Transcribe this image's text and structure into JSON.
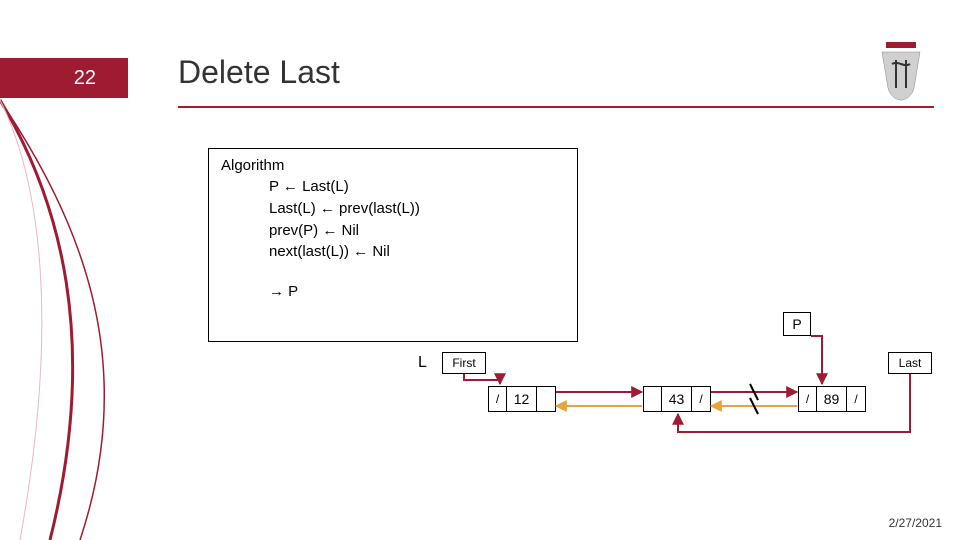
{
  "page_number": "22",
  "title": "Delete Last",
  "algorithm": {
    "heading": "Algorithm",
    "line1": "P ← Last(L)",
    "line2": "Last(L) ← prev(last(L))",
    "line3": "prev(P) ← Nil",
    "line4": "next(last(L)) ← Nil",
    "return": "→ P"
  },
  "diagram": {
    "p_label": "P",
    "l_label": "L",
    "first_label": "First",
    "last_label": "Last",
    "nodes": [
      {
        "prev": "/",
        "val": "12",
        "next": ""
      },
      {
        "prev": "",
        "val": "43",
        "next": "/"
      },
      {
        "prev": "/",
        "val": "89",
        "next": "/"
      }
    ]
  },
  "footer_date": "2/27/2021",
  "colors": {
    "accent": "#9e1b32"
  }
}
